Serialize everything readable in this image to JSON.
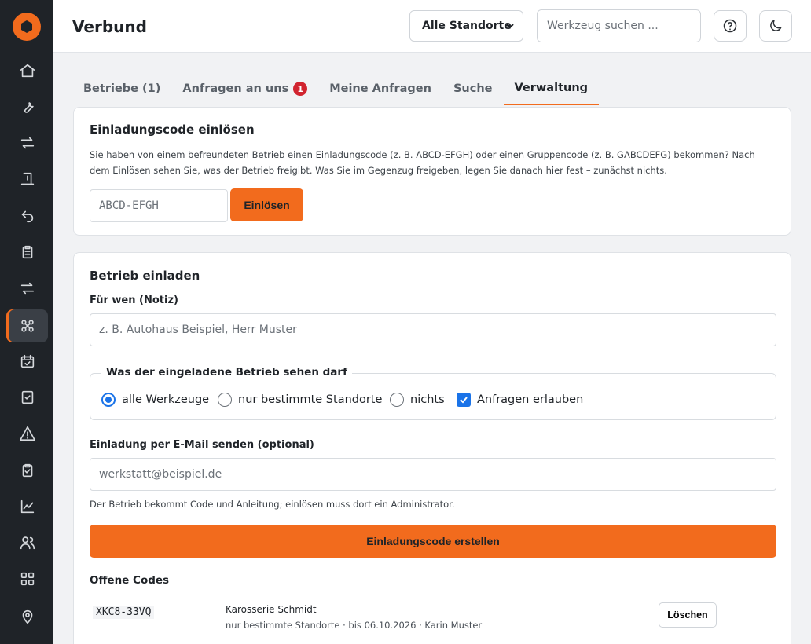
{
  "header": {
    "title": "Verbund",
    "location_select": "Alle Standorte",
    "search_placeholder": "Werkzeug suchen ..."
  },
  "sidebar": {
    "icons": [
      "home-icon",
      "wrench-icon",
      "transfer-icon",
      "receipt-icon",
      "undo-icon",
      "clipboard-icon",
      "swap-icon",
      "network-icon",
      "calendar-check-icon",
      "checkbox-icon",
      "warning-icon",
      "clipboard-check-icon",
      "chart-icon",
      "users-icon",
      "grid-icon",
      "location-pin-icon"
    ],
    "active_index": 7
  },
  "tabs": [
    {
      "label": "Betriebe (1)"
    },
    {
      "label": "Anfragen an uns",
      "badge": "1"
    },
    {
      "label": "Meine Anfragen"
    },
    {
      "label": "Suche"
    },
    {
      "label": "Verwaltung",
      "active": true
    }
  ],
  "redeem": {
    "title": "Einladungscode einlösen",
    "description_line1": "Sie haben von einem befreundeten Betrieb einen Einladungscode (z. B. ABCD-EFGH) oder einen Gruppencode (z. B. GABCDEFG) bekommen? Nach",
    "description_line2": "dem Einlösen sehen Sie, was der Betrieb freigibt. Was Sie im Gegenzug freigeben, legen Sie danach hier fest – zunächst nichts.",
    "code_placeholder": "ABCD-EFGH",
    "button": "Einlösen"
  },
  "invite": {
    "title": "Betrieb einladen",
    "for_whom_label": "Für wen (Notiz)",
    "for_whom_placeholder": "z. B. Autohaus Beispiel, Herr Muster",
    "visibility_legend": "Was der eingeladene Betrieb sehen darf",
    "options": {
      "all": "alle Werkzeuge",
      "some": "nur bestimmte Standorte",
      "none": "nichts",
      "allow_requests": "Anfragen erlauben"
    },
    "selected_option": "all",
    "allow_requests_checked": true,
    "email_label": "Einladung per E-Mail senden (optional)",
    "email_placeholder": "werkstatt@beispiel.de",
    "email_hint": "Der Betrieb bekommt Code und Anleitung; einlösen muss dort ein Administrator.",
    "create_button": "Einladungscode erstellen",
    "open_codes_title": "Offene Codes",
    "open_codes": [
      {
        "code": "XKC8-33VQ",
        "name": "Karosserie Schmidt",
        "details": "nur bestimmte Standorte · bis 06.10.2026 · Karin Muster",
        "action": "Löschen"
      }
    ]
  }
}
